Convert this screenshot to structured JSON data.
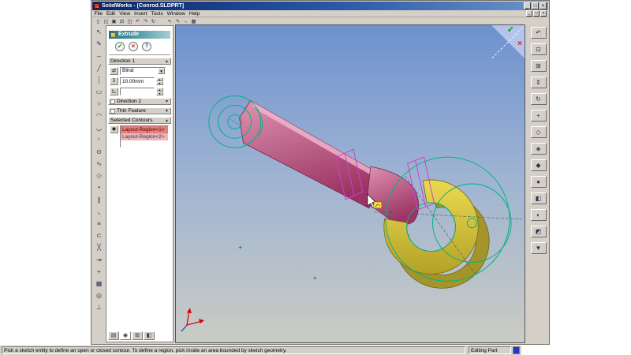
{
  "window": {
    "title": "SolidWorks - [Conrod.SLDPRT]",
    "controls": [
      {
        "name": "minimize-button",
        "glyph": "_"
      },
      {
        "name": "maximize-button",
        "glyph": "□"
      },
      {
        "name": "close-button",
        "glyph": "×"
      }
    ]
  },
  "menu": {
    "items": [
      {
        "name": "menu-file",
        "label": "File"
      },
      {
        "name": "menu-edit",
        "label": "Edit"
      },
      {
        "name": "menu-view",
        "label": "View"
      },
      {
        "name": "menu-insert",
        "label": "Insert"
      },
      {
        "name": "menu-tools",
        "label": "Tools"
      },
      {
        "name": "menu-window",
        "label": "Window"
      },
      {
        "name": "menu-help",
        "label": "Help"
      }
    ],
    "doc_controls": [
      {
        "name": "doc-minimize-button",
        "glyph": "_"
      },
      {
        "name": "doc-restore-button",
        "glyph": "□"
      },
      {
        "name": "doc-close-button",
        "glyph": "×"
      }
    ]
  },
  "toolbar": {
    "group1": [
      {
        "name": "new-document-icon",
        "glyph": "▯"
      },
      {
        "name": "open-icon",
        "glyph": "◱"
      },
      {
        "name": "save-icon",
        "glyph": "▣"
      },
      {
        "name": "print-icon",
        "glyph": "⊟"
      },
      {
        "name": "print-preview-icon",
        "glyph": "◫"
      },
      {
        "name": "undo-icon",
        "glyph": "↶"
      },
      {
        "name": "redo-icon",
        "glyph": "↷"
      },
      {
        "name": "rebuild-icon",
        "glyph": "↻"
      }
    ],
    "group2": [
      {
        "name": "select-icon",
        "glyph": "↖"
      },
      {
        "name": "sketch-icon",
        "glyph": "✎"
      },
      {
        "name": "dimension-icon",
        "glyph": "↔"
      },
      {
        "name": "grid-icon",
        "glyph": "▦"
      }
    ]
  },
  "sketch_toolbar": {
    "icons": [
      {
        "name": "select-icon",
        "glyph": "↖"
      },
      {
        "name": "sketch-icon",
        "glyph": "✎"
      },
      {
        "name": "dimension-icon",
        "glyph": "↔"
      },
      {
        "name": "line-icon",
        "glyph": "╱"
      },
      {
        "name": "centerline-icon",
        "glyph": "┆"
      },
      {
        "name": "rectangle-icon",
        "glyph": "▭"
      },
      {
        "name": "circle-icon",
        "glyph": "○"
      },
      {
        "name": "centerpoint-arc-icon",
        "glyph": "◠"
      },
      {
        "name": "tangent-arc-icon",
        "glyph": "◡"
      },
      {
        "name": "three-point-arc-icon",
        "glyph": "◜"
      },
      {
        "name": "ellipse-icon",
        "glyph": "⊙"
      },
      {
        "name": "spline-icon",
        "glyph": "∿"
      },
      {
        "name": "polygon-icon",
        "glyph": "◇"
      },
      {
        "name": "point-icon",
        "glyph": "•"
      },
      {
        "name": "mirror-entities-icon",
        "glyph": "∥"
      },
      {
        "name": "fillet-icon",
        "glyph": "◟"
      },
      {
        "name": "offset-entities-icon",
        "glyph": "≡"
      },
      {
        "name": "convert-entities-icon",
        "glyph": "⊂"
      },
      {
        "name": "trim-icon",
        "glyph": "╳"
      },
      {
        "name": "extend-icon",
        "glyph": "⇥"
      },
      {
        "name": "move-entities-icon",
        "glyph": "+"
      },
      {
        "name": "snap-grid-icon",
        "glyph": "▦"
      },
      {
        "name": "quick-snap-icon",
        "glyph": "◎"
      },
      {
        "name": "relations-icon",
        "glyph": "⊥"
      }
    ]
  },
  "view_toolbar": {
    "icons": [
      {
        "name": "previous-view-icon",
        "glyph": "↶"
      },
      {
        "name": "zoom-to-fit-icon",
        "glyph": "⊡"
      },
      {
        "name": "zoom-to-area-icon",
        "glyph": "⊞"
      },
      {
        "name": "zoom-in-out-icon",
        "glyph": "⇕"
      },
      {
        "name": "rotate-view-icon",
        "glyph": "↻"
      },
      {
        "name": "pan-icon",
        "glyph": "+"
      },
      {
        "name": "wireframe-icon",
        "glyph": "◇"
      },
      {
        "name": "hidden-lines-visible-icon",
        "glyph": "◈"
      },
      {
        "name": "hidden-lines-removed-icon",
        "glyph": "◆"
      },
      {
        "name": "shaded-icon",
        "glyph": "●"
      },
      {
        "name": "section-view-icon",
        "glyph": "◧"
      },
      {
        "name": "curvature-icon",
        "glyph": "◐"
      },
      {
        "name": "perspective-icon",
        "glyph": "◩"
      },
      {
        "name": "standard-views-icon",
        "glyph": "▼"
      }
    ]
  },
  "property_manager": {
    "title": "Extrude",
    "actions": {
      "ok": "✓",
      "cancel": "×",
      "help": "?"
    },
    "glyphs": {
      "collapse_up": "▲",
      "collapse_down": "▼",
      "combo_arrow": "▼",
      "spin_up": "▲",
      "spin_down": "▼",
      "reverse": "⇄",
      "depth": "↧",
      "draft": "◺",
      "contour": "◉"
    },
    "direction1": {
      "label": "Direction 1",
      "end_condition": "Blind",
      "depth": "10.00mm",
      "draft": ""
    },
    "direction2": {
      "label": "Direction 2"
    },
    "thin_feature": {
      "label": "Thin Feature"
    },
    "selected_contours": {
      "label": "Selected Contours",
      "items": [
        "Layout-Region<1>",
        "Layout-Region<2>"
      ]
    },
    "tabs": [
      {
        "name": "featuremanager-tab",
        "glyph": "▤"
      },
      {
        "name": "propertymanager-tab",
        "glyph": "◉"
      },
      {
        "name": "configurationmanager-tab",
        "glyph": "⊞"
      },
      {
        "name": "display-pane-tab",
        "glyph": "◧"
      }
    ]
  },
  "viewport": {
    "confirm_ok": "✓",
    "confirm_cancel": "×"
  },
  "status_bar": {
    "message": "Pick a sketch entity to define an open or closed contour. To define a region, pick inside an area bounded by sketch geometry.",
    "mode": "Editing Part"
  },
  "colors": {
    "title_bar": "#0a246a",
    "chrome": "#d4d0c8",
    "panel_header_teal": "#2e7d8c",
    "viewport_top": "#6d91cf",
    "viewport_bottom": "#cacbc4",
    "model_body_pink": "#b8487a",
    "model_extrude_yellow": "#d8c93e",
    "sketch_green": "#00b482",
    "profile_magenta": "#cf3fcf",
    "selection_salmon": "#e2807c"
  }
}
